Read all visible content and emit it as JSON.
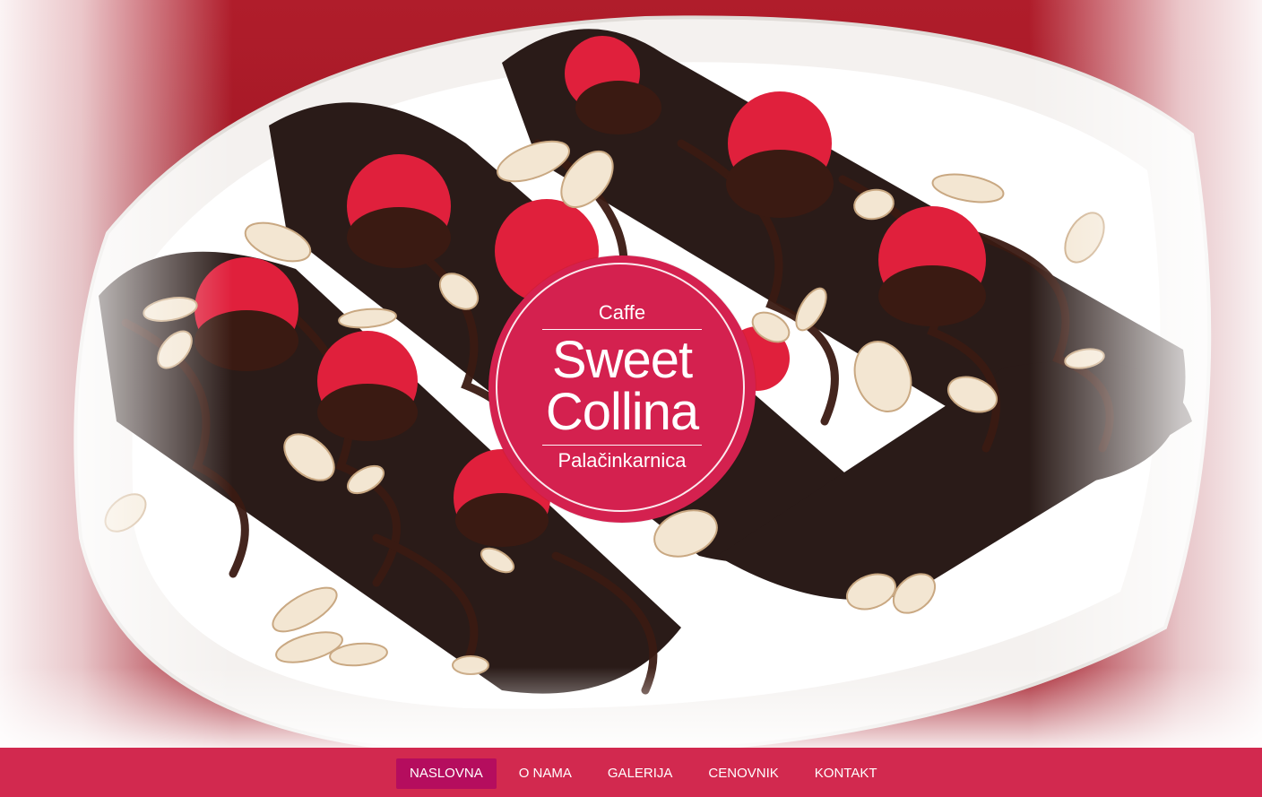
{
  "hero": {
    "image": "chocolate-crepes-with-raspberries-and-almonds"
  },
  "logo": {
    "top_text": "Caffe",
    "name_line1": "Sweet",
    "name_line2": "Collina",
    "bottom_text": "Palačinkarnica",
    "color": "#d4214f"
  },
  "nav": {
    "items": [
      {
        "label": "NASLOVNA",
        "active": true
      },
      {
        "label": "O NAMA",
        "active": false
      },
      {
        "label": "GALERIJA",
        "active": false
      },
      {
        "label": "CENOVNIK",
        "active": false
      },
      {
        "label": "KONTAKT",
        "active": false
      }
    ],
    "bar_color": "#d2294f",
    "active_color": "#b50d5e"
  }
}
